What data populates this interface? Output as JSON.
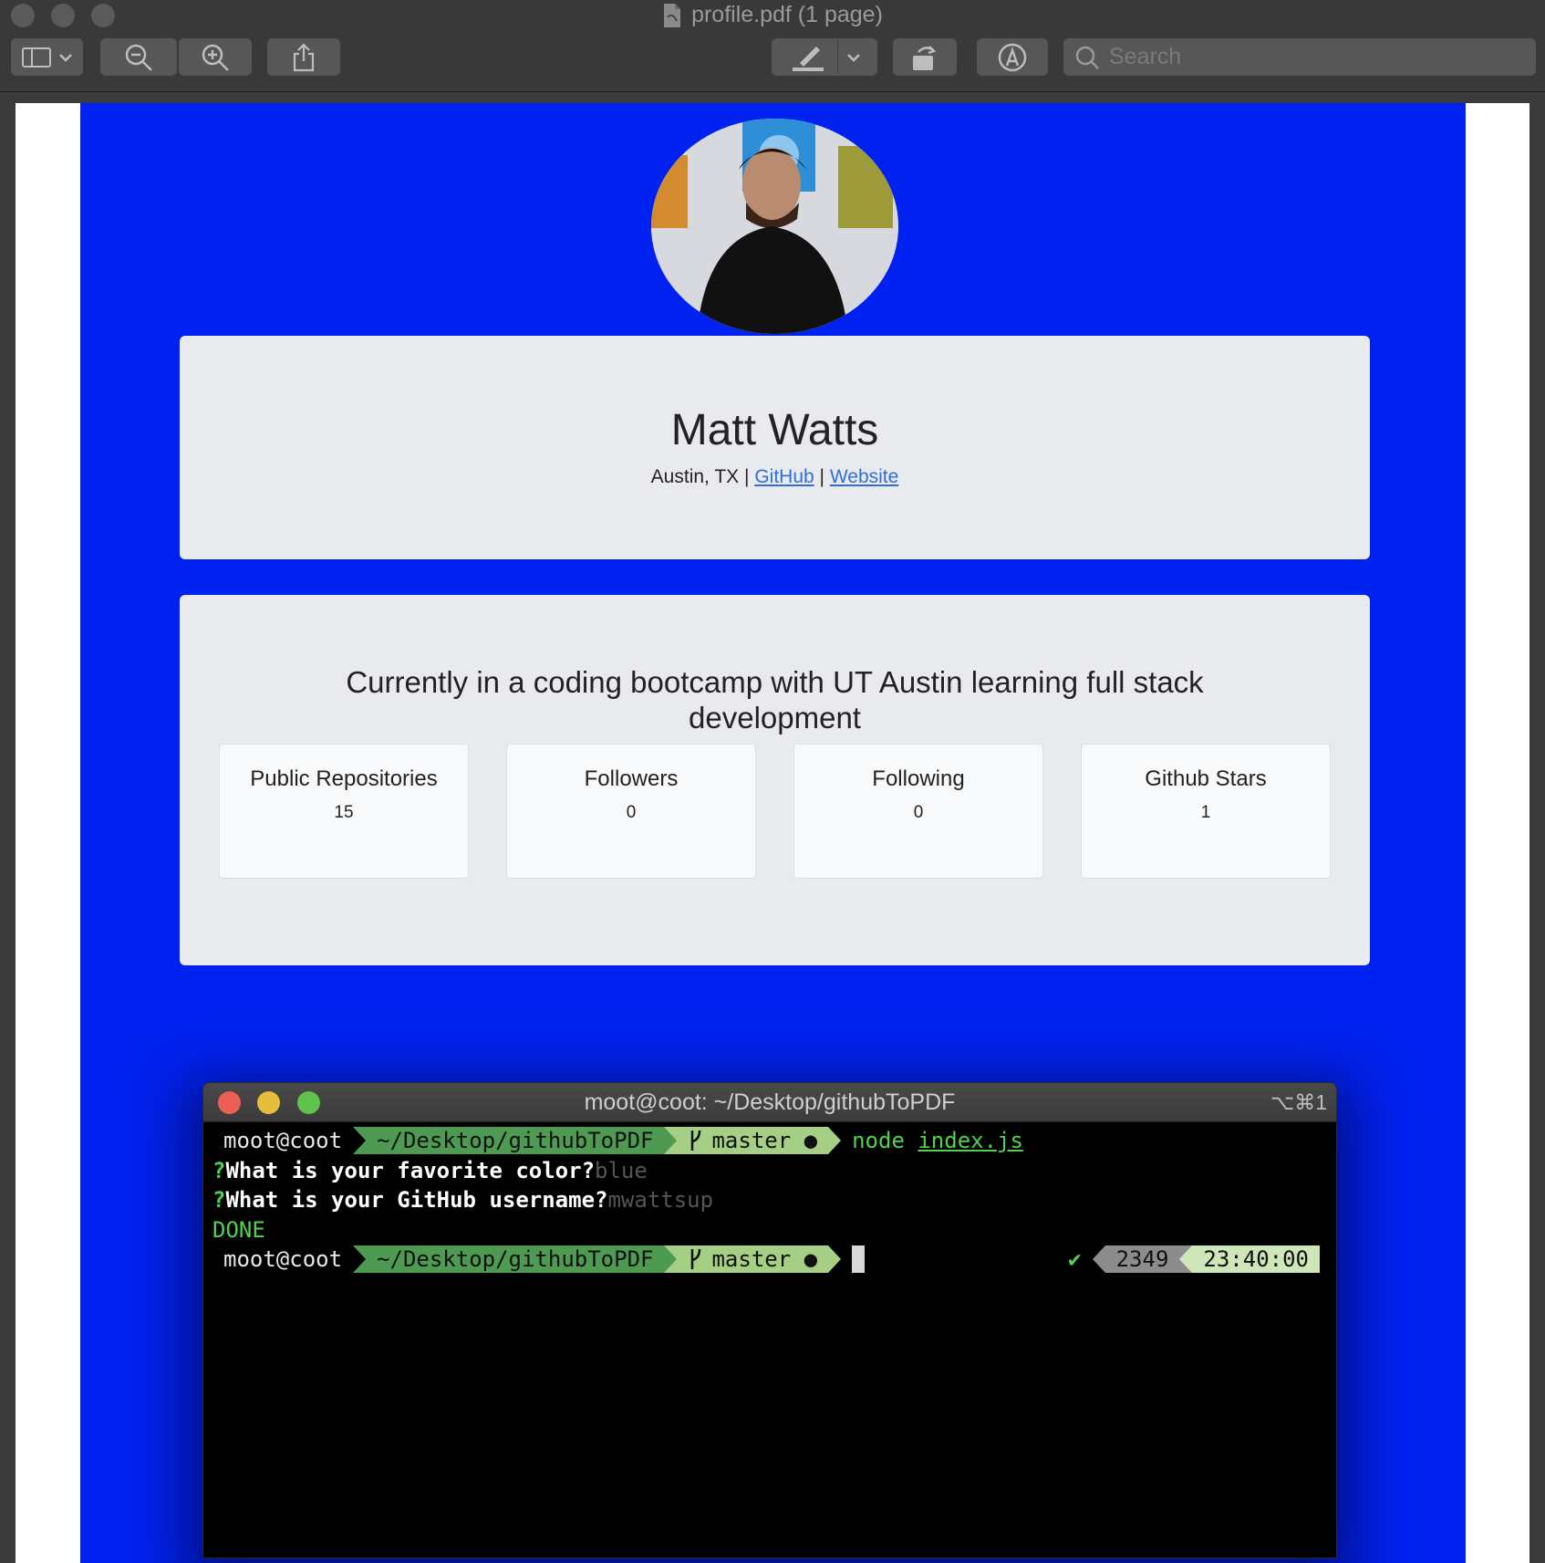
{
  "window": {
    "title": "profile.pdf (1 page)",
    "search_placeholder": "Search"
  },
  "toolbar": {
    "icons": [
      "sidebar-icon",
      "chevron-down-icon",
      "zoom-out-icon",
      "zoom-in-icon",
      "share-icon",
      "highlight-pen-icon",
      "chevron-down-icon",
      "rotate-icon",
      "markup-icon",
      "search-icon"
    ]
  },
  "profile": {
    "name": "Matt Watts",
    "location": "Austin, TX",
    "separator": "|",
    "github_link": "GitHub",
    "website_link": "Website",
    "bio": "Currently in a coding bootcamp with UT Austin learning full stack development",
    "accent_color": "#0022f0",
    "stats": [
      {
        "label": "Public Repositories",
        "value": "15"
      },
      {
        "label": "Followers",
        "value": "0"
      },
      {
        "label": "Following",
        "value": "0"
      },
      {
        "label": "Github Stars",
        "value": "1"
      }
    ]
  },
  "terminal": {
    "title": "moot@coot: ~/Desktop/githubToPDF",
    "shortcut": "⌥⌘1",
    "user": "moot@coot",
    "path": "~/Desktop/githubToPDF",
    "branch": "master",
    "branch_marker": "●",
    "command": "node",
    "command_arg": "index.js",
    "q_mark": "?",
    "q1": "What is your favorite color?",
    "a1": "blue",
    "q2": "What is your GitHub username?",
    "a2": "mwattsup",
    "done": "DONE",
    "check": "✔",
    "history_num": "2349",
    "time": "23:40:00"
  }
}
